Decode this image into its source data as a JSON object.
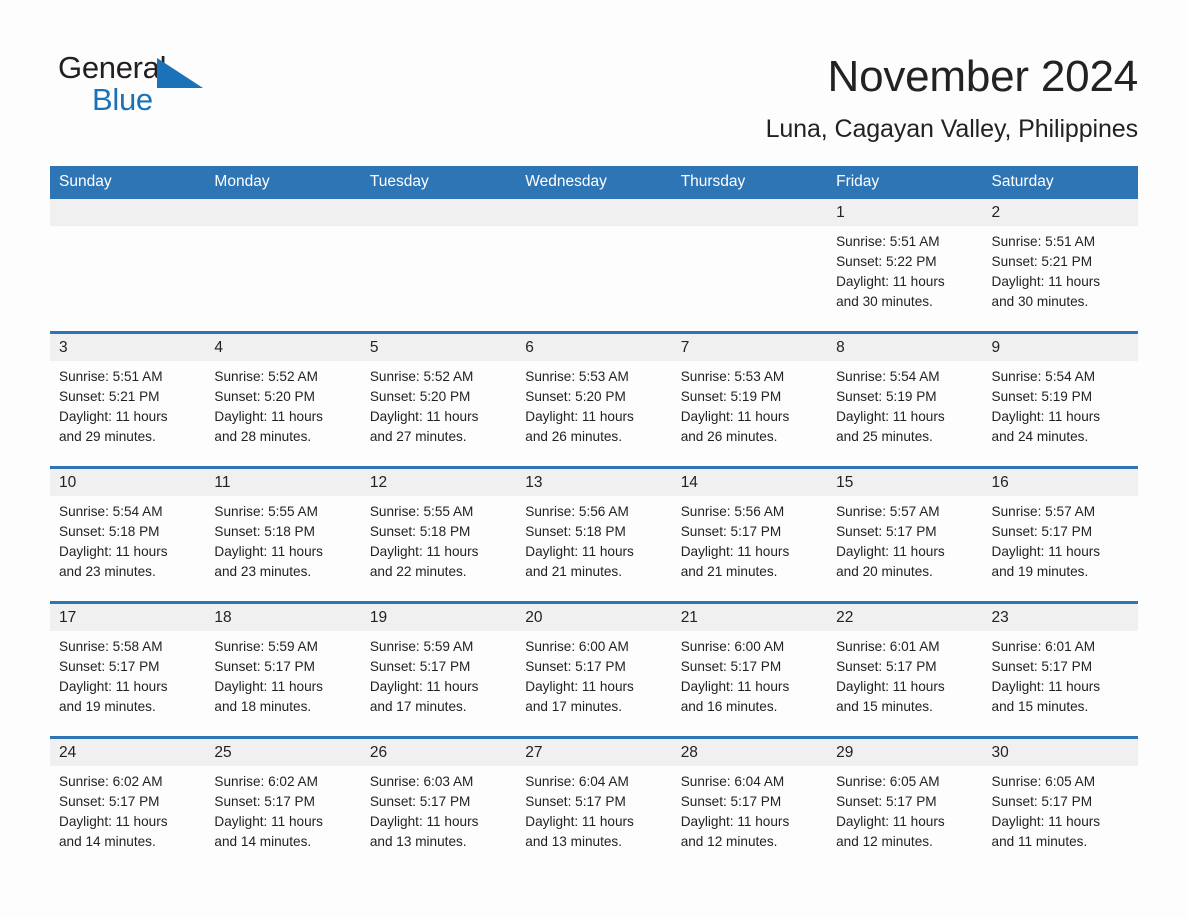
{
  "brand": {
    "word_one": "General",
    "word_two": "Blue",
    "accent_color": "#1c72b8",
    "flag_icon": "triangle-flag-icon"
  },
  "header": {
    "month_title": "November 2024",
    "location": "Luna, Cagayan Valley, Philippines"
  },
  "theme": {
    "header_blue": "#2e75b6",
    "daynum_band": "#f0f0f0",
    "page_background": "#fdfdfd",
    "text_color": "#222222"
  },
  "weekday_headers": [
    "Sunday",
    "Monday",
    "Tuesday",
    "Wednesday",
    "Thursday",
    "Friday",
    "Saturday"
  ],
  "weeks": [
    [
      {
        "day": "",
        "sunrise": "",
        "sunset": "",
        "daylight_line1": "",
        "daylight_line2": ""
      },
      {
        "day": "",
        "sunrise": "",
        "sunset": "",
        "daylight_line1": "",
        "daylight_line2": ""
      },
      {
        "day": "",
        "sunrise": "",
        "sunset": "",
        "daylight_line1": "",
        "daylight_line2": ""
      },
      {
        "day": "",
        "sunrise": "",
        "sunset": "",
        "daylight_line1": "",
        "daylight_line2": ""
      },
      {
        "day": "",
        "sunrise": "",
        "sunset": "",
        "daylight_line1": "",
        "daylight_line2": ""
      },
      {
        "day": "1",
        "sunrise": "Sunrise: 5:51 AM",
        "sunset": "Sunset: 5:22 PM",
        "daylight_line1": "Daylight: 11 hours",
        "daylight_line2": "and 30 minutes."
      },
      {
        "day": "2",
        "sunrise": "Sunrise: 5:51 AM",
        "sunset": "Sunset: 5:21 PM",
        "daylight_line1": "Daylight: 11 hours",
        "daylight_line2": "and 30 minutes."
      }
    ],
    [
      {
        "day": "3",
        "sunrise": "Sunrise: 5:51 AM",
        "sunset": "Sunset: 5:21 PM",
        "daylight_line1": "Daylight: 11 hours",
        "daylight_line2": "and 29 minutes."
      },
      {
        "day": "4",
        "sunrise": "Sunrise: 5:52 AM",
        "sunset": "Sunset: 5:20 PM",
        "daylight_line1": "Daylight: 11 hours",
        "daylight_line2": "and 28 minutes."
      },
      {
        "day": "5",
        "sunrise": "Sunrise: 5:52 AM",
        "sunset": "Sunset: 5:20 PM",
        "daylight_line1": "Daylight: 11 hours",
        "daylight_line2": "and 27 minutes."
      },
      {
        "day": "6",
        "sunrise": "Sunrise: 5:53 AM",
        "sunset": "Sunset: 5:20 PM",
        "daylight_line1": "Daylight: 11 hours",
        "daylight_line2": "and 26 minutes."
      },
      {
        "day": "7",
        "sunrise": "Sunrise: 5:53 AM",
        "sunset": "Sunset: 5:19 PM",
        "daylight_line1": "Daylight: 11 hours",
        "daylight_line2": "and 26 minutes."
      },
      {
        "day": "8",
        "sunrise": "Sunrise: 5:54 AM",
        "sunset": "Sunset: 5:19 PM",
        "daylight_line1": "Daylight: 11 hours",
        "daylight_line2": "and 25 minutes."
      },
      {
        "day": "9",
        "sunrise": "Sunrise: 5:54 AM",
        "sunset": "Sunset: 5:19 PM",
        "daylight_line1": "Daylight: 11 hours",
        "daylight_line2": "and 24 minutes."
      }
    ],
    [
      {
        "day": "10",
        "sunrise": "Sunrise: 5:54 AM",
        "sunset": "Sunset: 5:18 PM",
        "daylight_line1": "Daylight: 11 hours",
        "daylight_line2": "and 23 minutes."
      },
      {
        "day": "11",
        "sunrise": "Sunrise: 5:55 AM",
        "sunset": "Sunset: 5:18 PM",
        "daylight_line1": "Daylight: 11 hours",
        "daylight_line2": "and 23 minutes."
      },
      {
        "day": "12",
        "sunrise": "Sunrise: 5:55 AM",
        "sunset": "Sunset: 5:18 PM",
        "daylight_line1": "Daylight: 11 hours",
        "daylight_line2": "and 22 minutes."
      },
      {
        "day": "13",
        "sunrise": "Sunrise: 5:56 AM",
        "sunset": "Sunset: 5:18 PM",
        "daylight_line1": "Daylight: 11 hours",
        "daylight_line2": "and 21 minutes."
      },
      {
        "day": "14",
        "sunrise": "Sunrise: 5:56 AM",
        "sunset": "Sunset: 5:17 PM",
        "daylight_line1": "Daylight: 11 hours",
        "daylight_line2": "and 21 minutes."
      },
      {
        "day": "15",
        "sunrise": "Sunrise: 5:57 AM",
        "sunset": "Sunset: 5:17 PM",
        "daylight_line1": "Daylight: 11 hours",
        "daylight_line2": "and 20 minutes."
      },
      {
        "day": "16",
        "sunrise": "Sunrise: 5:57 AM",
        "sunset": "Sunset: 5:17 PM",
        "daylight_line1": "Daylight: 11 hours",
        "daylight_line2": "and 19 minutes."
      }
    ],
    [
      {
        "day": "17",
        "sunrise": "Sunrise: 5:58 AM",
        "sunset": "Sunset: 5:17 PM",
        "daylight_line1": "Daylight: 11 hours",
        "daylight_line2": "and 19 minutes."
      },
      {
        "day": "18",
        "sunrise": "Sunrise: 5:59 AM",
        "sunset": "Sunset: 5:17 PM",
        "daylight_line1": "Daylight: 11 hours",
        "daylight_line2": "and 18 minutes."
      },
      {
        "day": "19",
        "sunrise": "Sunrise: 5:59 AM",
        "sunset": "Sunset: 5:17 PM",
        "daylight_line1": "Daylight: 11 hours",
        "daylight_line2": "and 17 minutes."
      },
      {
        "day": "20",
        "sunrise": "Sunrise: 6:00 AM",
        "sunset": "Sunset: 5:17 PM",
        "daylight_line1": "Daylight: 11 hours",
        "daylight_line2": "and 17 minutes."
      },
      {
        "day": "21",
        "sunrise": "Sunrise: 6:00 AM",
        "sunset": "Sunset: 5:17 PM",
        "daylight_line1": "Daylight: 11 hours",
        "daylight_line2": "and 16 minutes."
      },
      {
        "day": "22",
        "sunrise": "Sunrise: 6:01 AM",
        "sunset": "Sunset: 5:17 PM",
        "daylight_line1": "Daylight: 11 hours",
        "daylight_line2": "and 15 minutes."
      },
      {
        "day": "23",
        "sunrise": "Sunrise: 6:01 AM",
        "sunset": "Sunset: 5:17 PM",
        "daylight_line1": "Daylight: 11 hours",
        "daylight_line2": "and 15 minutes."
      }
    ],
    [
      {
        "day": "24",
        "sunrise": "Sunrise: 6:02 AM",
        "sunset": "Sunset: 5:17 PM",
        "daylight_line1": "Daylight: 11 hours",
        "daylight_line2": "and 14 minutes."
      },
      {
        "day": "25",
        "sunrise": "Sunrise: 6:02 AM",
        "sunset": "Sunset: 5:17 PM",
        "daylight_line1": "Daylight: 11 hours",
        "daylight_line2": "and 14 minutes."
      },
      {
        "day": "26",
        "sunrise": "Sunrise: 6:03 AM",
        "sunset": "Sunset: 5:17 PM",
        "daylight_line1": "Daylight: 11 hours",
        "daylight_line2": "and 13 minutes."
      },
      {
        "day": "27",
        "sunrise": "Sunrise: 6:04 AM",
        "sunset": "Sunset: 5:17 PM",
        "daylight_line1": "Daylight: 11 hours",
        "daylight_line2": "and 13 minutes."
      },
      {
        "day": "28",
        "sunrise": "Sunrise: 6:04 AM",
        "sunset": "Sunset: 5:17 PM",
        "daylight_line1": "Daylight: 11 hours",
        "daylight_line2": "and 12 minutes."
      },
      {
        "day": "29",
        "sunrise": "Sunrise: 6:05 AM",
        "sunset": "Sunset: 5:17 PM",
        "daylight_line1": "Daylight: 11 hours",
        "daylight_line2": "and 12 minutes."
      },
      {
        "day": "30",
        "sunrise": "Sunrise: 6:05 AM",
        "sunset": "Sunset: 5:17 PM",
        "daylight_line1": "Daylight: 11 hours",
        "daylight_line2": "and 11 minutes."
      }
    ]
  ]
}
